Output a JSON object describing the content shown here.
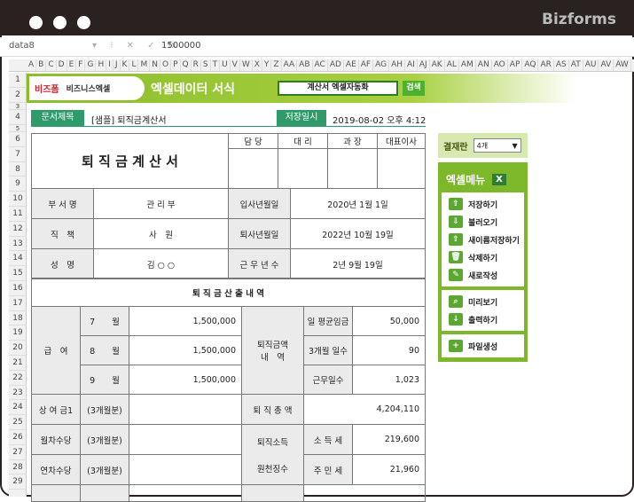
{
  "window": {
    "brand": "Bizforms"
  },
  "formula_bar": {
    "name_box": "data8",
    "buttons": "▾ ⁝ ✕ ✓ fx",
    "value": "1500000"
  },
  "column_headers": [
    "A",
    "B",
    "C",
    "D",
    "E",
    "F",
    "G",
    "H",
    "I",
    "J",
    "K",
    "L",
    "M",
    "N",
    "O",
    "P",
    "Q",
    "R",
    "S",
    "T",
    "U",
    "V",
    "W",
    "X",
    "Y",
    "Z",
    "AA",
    "AB",
    "AC",
    "AD",
    "AE",
    "AF",
    "AG",
    "AH",
    "AI",
    "AJ",
    "AK",
    "AL",
    "AM",
    "AN",
    "AO",
    "AP",
    "AQ",
    "AR",
    "AS",
    "AT",
    "AU",
    "AV",
    "AW"
  ],
  "row_numbers": [
    "1",
    "2",
    "3",
    "4",
    "5",
    "6",
    "7",
    "8",
    "9",
    "10",
    "11",
    "12",
    "13",
    "14",
    "15",
    "16",
    "17",
    "18",
    "19",
    "20",
    "21",
    "22",
    "23",
    "24",
    "25",
    "26",
    "27",
    "28",
    "29"
  ],
  "banner": {
    "logo1": "비즈폼",
    "logo2": "비즈니스엑셀",
    "title": "엑셀데이터 서식",
    "search_value": "계산서 엑셀자동화",
    "search_button": "검색"
  },
  "doc": {
    "title_label": "문서제목",
    "title": "[샘플] 퇴직금계산서",
    "saved_label": "저장일시",
    "saved_value": "2019-08-02  오후 4:12"
  },
  "form": {
    "heading": "퇴 직 금  계 산 서",
    "approvals": [
      "담 당",
      "대 리",
      "과 장",
      "대표이사"
    ],
    "info": [
      {
        "l1": "부 서 명",
        "v1": "관 리 부",
        "l2": "입사년월일",
        "v2": "2020년 1월 1일"
      },
      {
        "l1": "직　책",
        "v1": "사　원",
        "l2": "퇴사년월일",
        "v2": "2022년 10월 19일"
      },
      {
        "l1": "성　명",
        "v1": "김 ○ ○",
        "l2": "근 무 년 수",
        "v2": "2년  9월  19일"
      }
    ],
    "section": "퇴 직 금  산 출 내 역",
    "salary_label": "급　여",
    "months": [
      {
        "m": "7　　월",
        "v": "1,500,000"
      },
      {
        "m": "8　　월",
        "v": "1,500,000"
      },
      {
        "m": "9　　월",
        "v": "1,500,000"
      }
    ],
    "detail_label": "퇴직금액\n내　역",
    "details": [
      {
        "l": "일 평균임금",
        "v": "50,000"
      },
      {
        "l": "3개월 일수",
        "v": "90"
      },
      {
        "l": "근무일수",
        "v": "1,023"
      }
    ],
    "bonus": {
      "l": "상 여 금1",
      "p": "(3개월분)",
      "tl": "퇴 직 총 액",
      "tv": "4,204,110"
    },
    "monthly": {
      "l": "월차수당",
      "p": "(3개월분)"
    },
    "annual": {
      "l": "연차수당",
      "p": "(3개월분)"
    },
    "tax_label1": "퇴직소득",
    "tax_label2": "원천징수",
    "taxes": [
      {
        "l": "소 득 세",
        "v": "219,600"
      },
      {
        "l": "주 민 세",
        "v": "21,960"
      }
    ]
  },
  "side": {
    "approval_label": "결재란",
    "approval_value": "4개",
    "menu_title": "엑셀메뉴",
    "groups": [
      [
        "저장하기",
        "불러오기",
        "새이름저장하기",
        "삭제하기",
        "새로작성"
      ],
      [
        "미리보기",
        "출력하기"
      ],
      [
        "파일생성"
      ]
    ]
  }
}
